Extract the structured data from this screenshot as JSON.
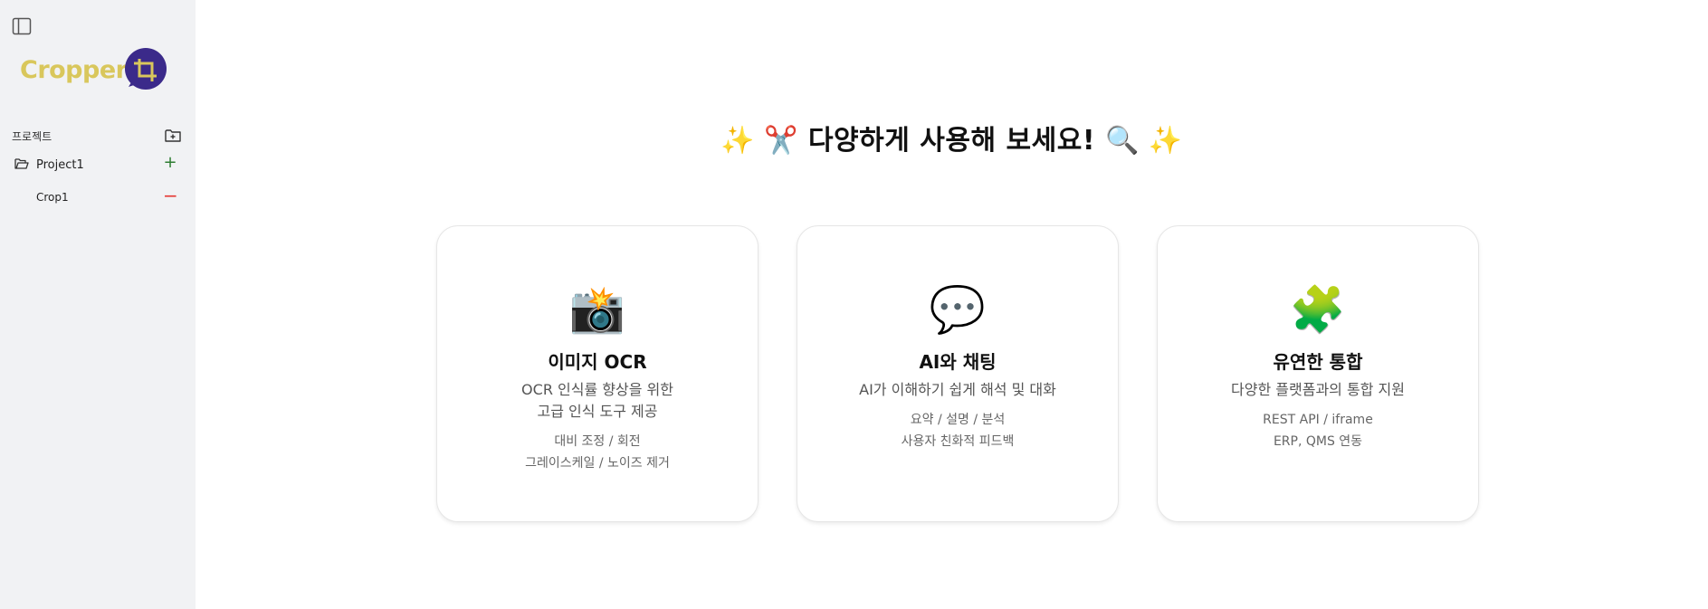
{
  "sidebar": {
    "logo_text": "Cropper",
    "projects_label": "프로젝트",
    "projects": [
      {
        "name": "Project1",
        "crops": [
          {
            "name": "Crop1"
          }
        ]
      }
    ]
  },
  "hero": {
    "title": "다양하게 사용해 보세요!",
    "emoji_left": "✨ ✂️",
    "emoji_right": "🔍 ✨"
  },
  "cards": [
    {
      "icon": "📸",
      "title": "이미지 OCR",
      "desc_lines": [
        "OCR 인식률 향상을 위한",
        "고급 인식 도구 제공"
      ],
      "features": [
        "대비 조정 / 회전",
        "그레이스케일 / 노이즈 제거"
      ]
    },
    {
      "icon": "💬",
      "title": "AI와 채팅",
      "desc_lines": [
        "AI가 이해하기 쉽게 해석 및 대화"
      ],
      "features": [
        "요약 / 설명 / 분석",
        "사용자 친화적 피드백"
      ]
    },
    {
      "icon": "🧩",
      "title": "유연한 통합",
      "desc_lines": [
        "다양한 플랫폼과의 통합 지원"
      ],
      "features": [
        "REST API / iframe",
        "ERP, QMS 연동"
      ]
    }
  ],
  "colors": {
    "sidebar_bg": "#f1f2f4",
    "logo_yellow": "#d9c75c",
    "logo_purple": "#3b2a8a",
    "add_green": "#2e7d32",
    "remove_red": "#e53935"
  }
}
